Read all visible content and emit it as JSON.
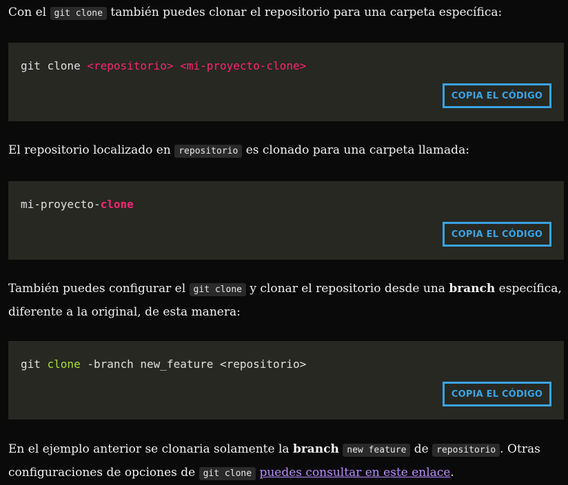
{
  "p1": {
    "a": "Con el ",
    "code": "git clone",
    "b": " también puedes clonar el repositorio para una carpeta específica:"
  },
  "block1": {
    "t1": "git clone ",
    "t2": "<repositorio>",
    "t3": " ",
    "t4": "<mi-proyecto-clone>",
    "button": "COPIA EL CÓDIGO"
  },
  "p2": {
    "a": "El repositorio localizado en ",
    "code": "repositorio",
    "b": " es clonado para una carpeta llamada:"
  },
  "block2": {
    "t1": "mi-proyecto-",
    "t2": "clone",
    "button": "COPIA EL CÓDIGO"
  },
  "p3": {
    "a": "También puedes configurar el ",
    "code": "git clone",
    "b": " y clonar el repositorio desde una ",
    "bold": "branch",
    "c": " específica,",
    "line2": "diferente a la original, de esta manera:"
  },
  "block3": {
    "t1": "git ",
    "t2": "clone",
    "t3": " -branch new_feature <repositorio>",
    "button": "COPIA EL CÓDIGO"
  },
  "p4": {
    "a": "En el ejemplo anterior se clonaria solamente la ",
    "bold": "branch",
    "b": " ",
    "code1": "new feature",
    "c": " de ",
    "code2": "repositorio",
    "d": ". Otras",
    "line2a": "configuraciones de opciones de ",
    "code3": "git clone",
    "line2b": " ",
    "link": "puedes consultar en este enlace",
    "line2c": "."
  },
  "colors": {
    "accent": "#3aa3e3",
    "code_bg": "#272822",
    "keyword_pink": "#f92672",
    "keyword_green": "#a6e22e",
    "link": "#b98cff"
  }
}
